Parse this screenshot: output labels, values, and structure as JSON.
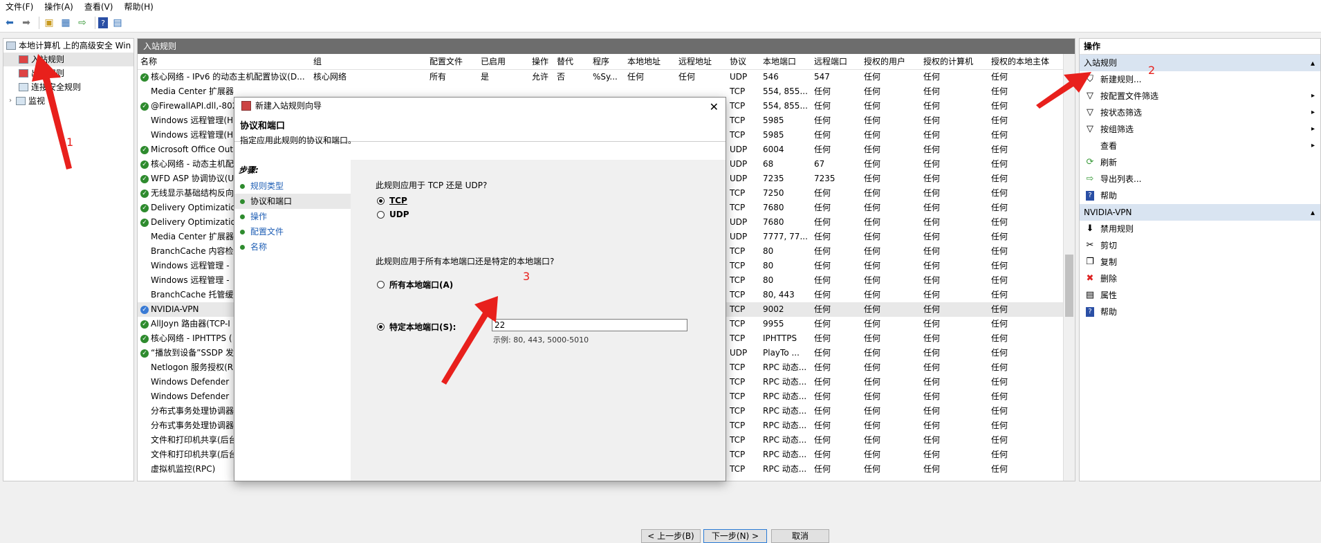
{
  "menu": [
    "文件(F)",
    "操作(A)",
    "查看(V)",
    "帮助(H)"
  ],
  "tree": {
    "root": "本地计算机 上的高级安全 Win",
    "items": [
      "入站规则",
      "出站规则",
      "连接安全规则",
      "监视"
    ]
  },
  "center": {
    "title": "入站规则",
    "columns": [
      "名称",
      "组",
      "配置文件",
      "已启用",
      "操作",
      "替代",
      "程序",
      "本地地址",
      "远程地址",
      "协议",
      "本地端口",
      "远程端口",
      "授权的用户",
      "授权的计算机",
      "授权的本地主体"
    ],
    "rows": [
      {
        "icon": "check",
        "name": "核心网络 - IPv6 的动态主机配置协议(D...",
        "group": "核心网络",
        "profile": "所有",
        "enabled": "是",
        "action": "允许",
        "override": "否",
        "program": "%Sy...",
        "local": "任何",
        "remote": "任何",
        "proto": "UDP",
        "lport": "546",
        "rport": "547",
        "auser": "任何",
        "acomp": "任何",
        "aprin": "任何"
      },
      {
        "icon": "none",
        "name": "Media Center 扩展器",
        "group": "",
        "profile": "",
        "enabled": "",
        "action": "",
        "override": "",
        "program": "",
        "local": "",
        "remote": "",
        "proto": "TCP",
        "lport": "554, 855...",
        "rport": "任何",
        "auser": "任何",
        "acomp": "任何",
        "aprin": "任何"
      },
      {
        "icon": "check",
        "name": "@FirewallAPI.dll,-802",
        "group": "",
        "profile": "",
        "enabled": "",
        "action": "",
        "override": "",
        "program": "",
        "local": "",
        "remote": "",
        "proto": "TCP",
        "lport": "554, 855...",
        "rport": "任何",
        "auser": "任何",
        "acomp": "任何",
        "aprin": "任何"
      },
      {
        "icon": "none",
        "name": "Windows 远程管理(H",
        "group": "",
        "profile": "",
        "enabled": "",
        "action": "",
        "override": "",
        "program": "",
        "local": "",
        "remote": "",
        "proto": "TCP",
        "lport": "5985",
        "rport": "任何",
        "auser": "任何",
        "acomp": "任何",
        "aprin": "任何"
      },
      {
        "icon": "none",
        "name": "Windows 远程管理(H",
        "group": "",
        "profile": "",
        "enabled": "",
        "action": "",
        "override": "",
        "program": "",
        "local": "",
        "remote": "",
        "proto": "TCP",
        "lport": "5985",
        "rport": "任何",
        "auser": "任何",
        "acomp": "任何",
        "aprin": "任何"
      },
      {
        "icon": "check",
        "name": "Microsoft Office Out",
        "group": "",
        "profile": "",
        "enabled": "",
        "action": "",
        "override": "",
        "program": "",
        "local": "",
        "remote": "",
        "proto": "UDP",
        "lport": "6004",
        "rport": "任何",
        "auser": "任何",
        "acomp": "任何",
        "aprin": "任何"
      },
      {
        "icon": "check",
        "name": "核心网络 - 动态主机配",
        "group": "",
        "profile": "",
        "enabled": "",
        "action": "",
        "override": "",
        "program": "",
        "local": "",
        "remote": "",
        "proto": "UDP",
        "lport": "68",
        "rport": "67",
        "auser": "任何",
        "acomp": "任何",
        "aprin": "任何"
      },
      {
        "icon": "check",
        "name": "WFD ASP 协调协议(U",
        "group": "",
        "profile": "",
        "enabled": "",
        "action": "",
        "override": "",
        "program": "",
        "local": "",
        "remote": "",
        "proto": "UDP",
        "lport": "7235",
        "rport": "7235",
        "auser": "任何",
        "acomp": "任何",
        "aprin": "任何"
      },
      {
        "icon": "check",
        "name": "无线显示基础结构反向",
        "group": "",
        "profile": "",
        "enabled": "",
        "action": "",
        "override": "",
        "program": "",
        "local": "",
        "remote": "",
        "proto": "TCP",
        "lport": "7250",
        "rport": "任何",
        "auser": "任何",
        "acomp": "任何",
        "aprin": "任何"
      },
      {
        "icon": "check",
        "name": "Delivery Optimizatio",
        "group": "",
        "profile": "",
        "enabled": "",
        "action": "",
        "override": "",
        "program": "",
        "local": "",
        "remote": "",
        "proto": "TCP",
        "lport": "7680",
        "rport": "任何",
        "auser": "任何",
        "acomp": "任何",
        "aprin": "任何"
      },
      {
        "icon": "check",
        "name": "Delivery Optimizatio",
        "group": "",
        "profile": "",
        "enabled": "",
        "action": "",
        "override": "",
        "program": "",
        "local": "",
        "remote": "",
        "proto": "UDP",
        "lport": "7680",
        "rport": "任何",
        "auser": "任何",
        "acomp": "任何",
        "aprin": "任何"
      },
      {
        "icon": "none",
        "name": "Media Center 扩展器",
        "group": "",
        "profile": "",
        "enabled": "",
        "action": "",
        "override": "",
        "program": "",
        "local": "",
        "remote": "",
        "proto": "UDP",
        "lport": "7777, 77...",
        "rport": "任何",
        "auser": "任何",
        "acomp": "任何",
        "aprin": "任何"
      },
      {
        "icon": "none",
        "name": "BranchCache 内容检",
        "group": "",
        "profile": "",
        "enabled": "",
        "action": "",
        "override": "",
        "program": "",
        "local": "",
        "remote": "",
        "proto": "TCP",
        "lport": "80",
        "rport": "任何",
        "auser": "任何",
        "acomp": "任何",
        "aprin": "任何"
      },
      {
        "icon": "none",
        "name": "Windows 远程管理 -",
        "group": "",
        "profile": "",
        "enabled": "",
        "action": "",
        "override": "",
        "program": "",
        "local": "",
        "remote": "",
        "proto": "TCP",
        "lport": "80",
        "rport": "任何",
        "auser": "任何",
        "acomp": "任何",
        "aprin": "任何"
      },
      {
        "icon": "none",
        "name": "Windows 远程管理 -",
        "group": "",
        "profile": "",
        "enabled": "",
        "action": "",
        "override": "",
        "program": "",
        "local": "",
        "remote": "",
        "proto": "TCP",
        "lport": "80",
        "rport": "任何",
        "auser": "任何",
        "acomp": "任何",
        "aprin": "任何"
      },
      {
        "icon": "none",
        "name": "BranchCache 托管缓",
        "group": "",
        "profile": "",
        "enabled": "",
        "action": "",
        "override": "",
        "program": "",
        "local": "",
        "remote": "",
        "proto": "TCP",
        "lport": "80, 443",
        "rport": "任何",
        "auser": "任何",
        "acomp": "任何",
        "aprin": "任何"
      },
      {
        "icon": "vpn",
        "name": "NVIDIA-VPN",
        "group": "",
        "profile": "",
        "enabled": "",
        "action": "",
        "override": "",
        "program": "",
        "local": "",
        "remote": "",
        "proto": "TCP",
        "lport": "9002",
        "rport": "任何",
        "auser": "任何",
        "acomp": "任何",
        "aprin": "任何"
      },
      {
        "icon": "check",
        "name": "AllJoyn 路由器(TCP-I",
        "group": "",
        "profile": "",
        "enabled": "",
        "action": "",
        "override": "",
        "program": "",
        "local": "",
        "remote": "",
        "proto": "TCP",
        "lport": "9955",
        "rport": "任何",
        "auser": "任何",
        "acomp": "任何",
        "aprin": "任何"
      },
      {
        "icon": "check",
        "name": "核心网络 - IPHTTPS (",
        "group": "",
        "profile": "",
        "enabled": "",
        "action": "",
        "override": "",
        "program": "",
        "local": "",
        "remote": "",
        "proto": "TCP",
        "lport": "IPHTTPS",
        "rport": "任何",
        "auser": "任何",
        "acomp": "任何",
        "aprin": "任何"
      },
      {
        "icon": "check",
        "name": "“播放到设备”SSDP 发",
        "group": "",
        "profile": "",
        "enabled": "",
        "action": "",
        "override": "",
        "program": "",
        "local": "",
        "remote": "",
        "proto": "UDP",
        "lport": "PlayTo ...",
        "rport": "任何",
        "auser": "任何",
        "acomp": "任何",
        "aprin": "任何"
      },
      {
        "icon": "none",
        "name": "Netlogon 服务授权(R",
        "group": "",
        "profile": "",
        "enabled": "",
        "action": "",
        "override": "",
        "program": "",
        "local": "",
        "remote": "",
        "proto": "TCP",
        "lport": "RPC 动态...",
        "rport": "任何",
        "auser": "任何",
        "acomp": "任何",
        "aprin": "任何"
      },
      {
        "icon": "none",
        "name": "Windows Defender",
        "group": "",
        "profile": "",
        "enabled": "",
        "action": "",
        "override": "",
        "program": "",
        "local": "",
        "remote": "",
        "proto": "TCP",
        "lport": "RPC 动态...",
        "rport": "任何",
        "auser": "任何",
        "acomp": "任何",
        "aprin": "任何"
      },
      {
        "icon": "none",
        "name": "Windows Defender",
        "group": "",
        "profile": "",
        "enabled": "",
        "action": "",
        "override": "",
        "program": "",
        "local": "",
        "remote": "",
        "proto": "TCP",
        "lport": "RPC 动态...",
        "rport": "任何",
        "auser": "任何",
        "acomp": "任何",
        "aprin": "任何"
      },
      {
        "icon": "none",
        "name": "分布式事务处理协调器",
        "group": "",
        "profile": "",
        "enabled": "",
        "action": "",
        "override": "",
        "program": "",
        "local": "",
        "remote": "",
        "proto": "TCP",
        "lport": "RPC 动态...",
        "rport": "任何",
        "auser": "任何",
        "acomp": "任何",
        "aprin": "任何"
      },
      {
        "icon": "none",
        "name": "分布式事务处理协调器",
        "group": "",
        "profile": "",
        "enabled": "",
        "action": "",
        "override": "",
        "program": "",
        "local": "",
        "remote": "",
        "proto": "TCP",
        "lport": "RPC 动态...",
        "rport": "任何",
        "auser": "任何",
        "acomp": "任何",
        "aprin": "任何"
      },
      {
        "icon": "none",
        "name": "文件和打印机共享(后台",
        "group": "",
        "profile": "",
        "enabled": "",
        "action": "",
        "override": "",
        "program": "",
        "local": "",
        "remote": "",
        "proto": "TCP",
        "lport": "RPC 动态...",
        "rport": "任何",
        "auser": "任何",
        "acomp": "任何",
        "aprin": "任何"
      },
      {
        "icon": "none",
        "name": "文件和打印机共享(后台",
        "group": "",
        "profile": "",
        "enabled": "",
        "action": "",
        "override": "",
        "program": "",
        "local": "",
        "remote": "",
        "proto": "TCP",
        "lport": "RPC 动态...",
        "rport": "任何",
        "auser": "任何",
        "acomp": "任何",
        "aprin": "任何"
      },
      {
        "icon": "none",
        "name": "虚拟机监控(RPC)",
        "group": "",
        "profile": "",
        "enabled": "",
        "action": "",
        "override": "",
        "program": "",
        "local": "",
        "remote": "",
        "proto": "TCP",
        "lport": "RPC 动态...",
        "rport": "任何",
        "auser": "任何",
        "acomp": "任何",
        "aprin": "任何"
      }
    ]
  },
  "actions": {
    "header": "操作",
    "section1": "入站规则",
    "items1": [
      {
        "icon": "new-rule-icon",
        "label": "新建规则...",
        "arrow": ""
      },
      {
        "icon": "filter-icon",
        "label": "按配置文件筛选",
        "arrow": "▸"
      },
      {
        "icon": "filter-icon",
        "label": "按状态筛选",
        "arrow": "▸"
      },
      {
        "icon": "filter-icon",
        "label": "按组筛选",
        "arrow": "▸"
      },
      {
        "icon": "none",
        "label": "查看",
        "arrow": "▸"
      },
      {
        "icon": "refresh-icon",
        "label": "刷新",
        "arrow": ""
      },
      {
        "icon": "export-icon",
        "label": "导出列表...",
        "arrow": ""
      },
      {
        "icon": "help-icon",
        "label": "帮助",
        "arrow": ""
      }
    ],
    "section2": "NVIDIA-VPN",
    "items2": [
      {
        "icon": "disable-icon",
        "label": "禁用规则"
      },
      {
        "icon": "cut-icon",
        "label": "剪切"
      },
      {
        "icon": "copy-icon",
        "label": "复制"
      },
      {
        "icon": "delete-icon",
        "label": "删除"
      },
      {
        "icon": "properties-icon",
        "label": "属性"
      },
      {
        "icon": "help-icon",
        "label": "帮助"
      }
    ]
  },
  "dialog": {
    "title": "新建入站规则向导",
    "heading": "协议和端口",
    "subtitle": "指定应用此规则的协议和端口。",
    "steps_title": "步骤:",
    "steps": [
      "规则类型",
      "协议和端口",
      "操作",
      "配置文件",
      "名称"
    ],
    "q1": "此规则应用于 TCP 还是 UDP?",
    "tcp": "TCP",
    "udp": "UDP",
    "q2": "此规则应用于所有本地端口还是特定的本地端口?",
    "all_ports": "所有本地端口(A)",
    "specific_ports": "特定本地端口(S):",
    "port_value": "22",
    "example": "示例: 80, 443, 5000-5010",
    "btn_back": "< 上一步(B)",
    "btn_next": "下一步(N) >",
    "btn_cancel": "取消"
  },
  "annotations": {
    "n1": "1",
    "n2": "2",
    "n3": "3",
    "color": "#e8201c"
  }
}
